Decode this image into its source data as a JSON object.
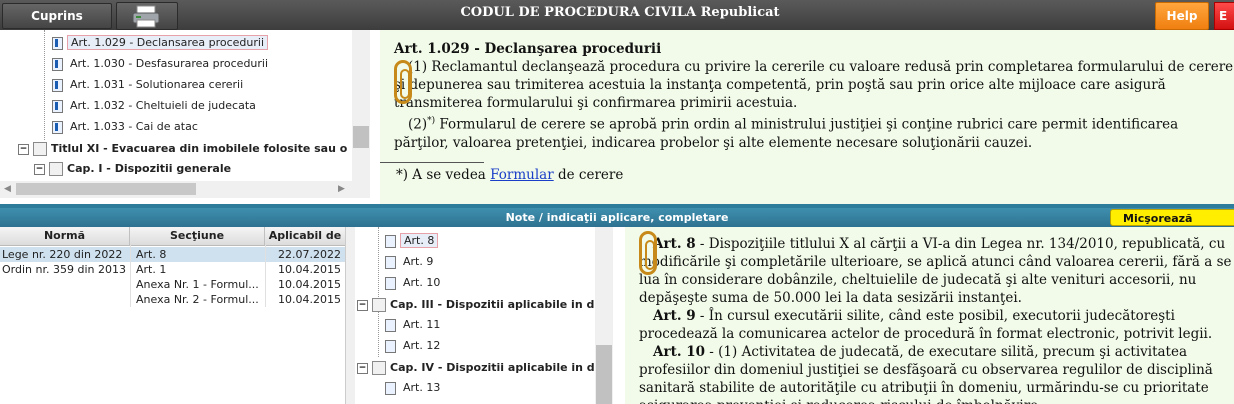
{
  "header": {
    "cuprins_label": "Cuprins restrâns",
    "title": "CODUL DE PROCEDURA CIVILA Republicat",
    "help_label": "Help",
    "exit_label": "E"
  },
  "tree_top": {
    "items": [
      {
        "label": "Art. 1.029 - Declansarea procedurii",
        "selected": true
      },
      {
        "label": "Art. 1.030 - Desfasurarea procedurii"
      },
      {
        "label": "Art. 1.031 - Solutionarea cererii"
      },
      {
        "label": "Art. 1.032 - Cheltuieli de judecata"
      },
      {
        "label": "Art. 1.033 - Cai de atac"
      }
    ],
    "titlu": "Titlul XI - Evacuarea din imobilele folosite sau o",
    "cap": "Cap. I - Dispozitii generale"
  },
  "article_top": {
    "heading": "Art. 1.029 - Declanşarea procedurii",
    "p1": "(1) Reclamantul declanşează procedura cu privire la cererile cu valoare redusă prin completarea formularului de cerere şi depunerea sau trimiterea acestuia la instanţa competentă, prin poştă sau prin orice alte mijloace care asigură transmiterea formularului şi confirmarea primirii acestuia.",
    "p2_num": "(2)",
    "p2_sup": "*)",
    "p2": " Formularul de cerere se aprobă prin ordin al ministrului justiţiei şi conţine rubrici care permit identificarea părţilor, valoarea pretenţiei, indicarea probelor şi alte elemente necesare soluţionării cauzei.",
    "footnote_prefix": "*) A se vedea ",
    "footnote_link": "Formular",
    "footnote_suffix": " de cerere"
  },
  "notes": {
    "bar_title": "Note / indicaţii aplicare, completare",
    "shrink_button": "Micşorează fereastra"
  },
  "table": {
    "headers": [
      "Normă",
      "Secţiune",
      "Aplicabil de la"
    ],
    "rows": [
      [
        "Lege nr. 220 din 2022",
        "Art. 8",
        "22.07.2022"
      ],
      [
        "Ordin nr. 359 din 2013",
        "Art. 1",
        "10.04.2015"
      ],
      [
        "",
        "Anexa Nr. 1 - Formul...",
        "10.04.2015"
      ],
      [
        "",
        "Anexa Nr. 2 - Formul...",
        "10.04.2015"
      ]
    ]
  },
  "tree_bot": {
    "art8": "Art. 8",
    "art9": "Art. 9",
    "art10": "Art. 10",
    "cap3": "Cap. III - Dispozitii aplicabile in d",
    "art11": "Art. 11",
    "art12": "Art. 12",
    "cap4": "Cap. IV - Dispozitii aplicabile in d",
    "art13": "Art. 13"
  },
  "article_bot": {
    "a8_head": "Art. 8",
    "a8": " - Dispoziţiile titlului X al cărţii a VI-a din Legea nr. 134/2010, republicată, cu modificările şi completările ulterioare, se aplică atunci când valoarea cererii, fără a se lua în considerare dobânzile, cheltuielile de judecată şi alte venituri accesorii, nu depăşeşte suma de 50.000 lei la data sesizării instanţei.",
    "a9_head": "Art. 9",
    "a9": " - În cursul executării silite, când este posibil, executorii judecătoreşti procedează la comunicarea actelor de procedură în format electronic, potrivit legii.",
    "a10_head": "Art. 10",
    "a10": " - (1) Activitatea de judecată, de executare silită, precum şi activitatea profesiilor din domeniul justiţiei se desfăşoară cu observarea regulilor de disciplină sanitară stabilite de autorităţile cu atribuţii în domeniu, urmărindu-se cu prioritate asigurarea prevenţiei şi reducerea riscului de îmbolnăvire."
  }
}
